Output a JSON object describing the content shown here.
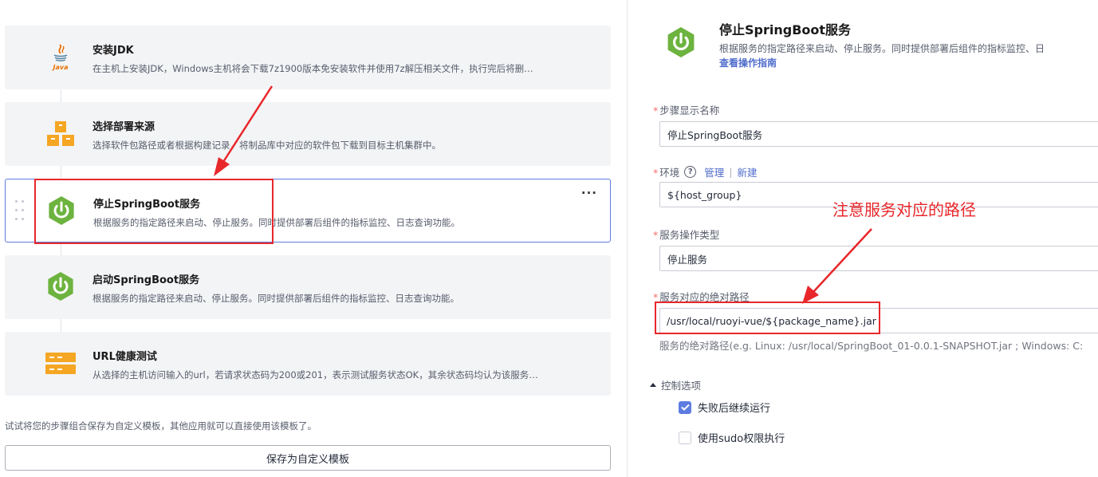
{
  "steps": [
    {
      "title": "安装JDK",
      "desc": "在主机上安装JDK，Windows主机将会下载7z1900版本免安装软件并使用7z解压相关文件，执行完后将删…",
      "icon": "java-icon"
    },
    {
      "title": "选择部署来源",
      "desc": "选择软件包路径或者根据构建记录，将制品库中对应的软件包下载到目标主机集群中。",
      "icon": "package-boxes-icon"
    },
    {
      "title": "停止SpringBoot服务",
      "desc": "根据服务的指定路径来启动、停止服务。同时提供部署后组件的指标监控、日志查询功能。",
      "icon": "springboot-power-icon"
    },
    {
      "title": "启动SpringBoot服务",
      "desc": "根据服务的指定路径来启动、停止服务。同时提供部署后组件的指标监控、日志查询功能。",
      "icon": "springboot-power-icon"
    },
    {
      "title": "URL健康测试",
      "desc": "从选择的主机访问输入的url，若请求状态码为200或201，表示测试服务状态OK，其余状态码均认为该服务…",
      "icon": "server-rack-icon"
    }
  ],
  "more_label": "···",
  "hint": "试试将您的步骤组合保存为自定义模板，其他应用就可以直接使用该模板了。",
  "save_template_label": "保存为自定义模板",
  "detail": {
    "title": "停止SpringBoot服务",
    "desc": "根据服务的指定路径来启动、停止服务。同时提供部署后组件的指标监控、日",
    "guide_link": "查看操作指南"
  },
  "form": {
    "step_name": {
      "label": "步骤显示名称",
      "value": "停止SpringBoot服务"
    },
    "env": {
      "label": "环境",
      "help": "?",
      "manage": "管理",
      "sep": "|",
      "create": "新建",
      "value": "${host_group}"
    },
    "op_type": {
      "label": "服务操作类型",
      "value": "停止服务"
    },
    "path": {
      "label": "服务对应的绝对路径",
      "value": "/usr/local/ruoyi-vue/${package_name}.jar",
      "help": "服务的绝对路径(e.g. Linux: /usr/local/SpringBoot_01-0.0.1-SNAPSHOT.jar ; Windows: C:"
    }
  },
  "required_mark": "*",
  "control": {
    "header": "控制选项",
    "continue_on_fail": {
      "label": "失败后继续运行",
      "checked": true
    },
    "use_sudo": {
      "label": "使用sudo权限执行",
      "checked": false
    }
  },
  "annotation": "注意服务对应的路径",
  "colors": {
    "accent": "#5e7ce0",
    "spring_green": "#6db33f",
    "annotation_red": "#e8272b",
    "orange": "#f5a623"
  }
}
